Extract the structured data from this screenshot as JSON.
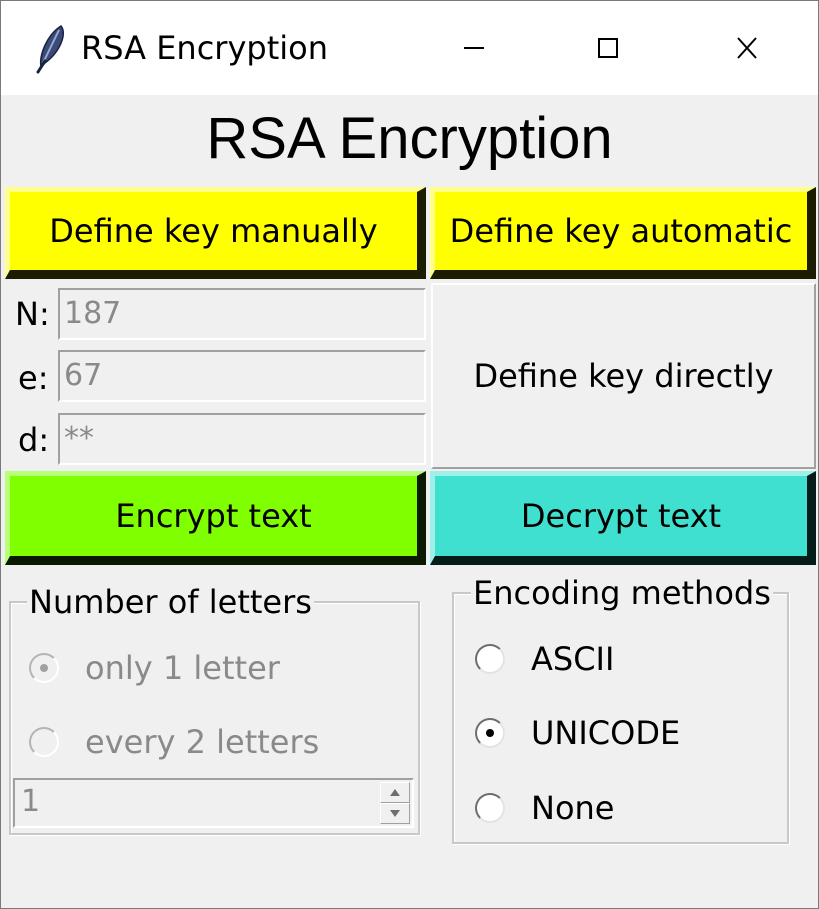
{
  "window": {
    "title": "RSA Encryption",
    "icon": "feather-icon",
    "controls": [
      "minimize-icon",
      "maximize-icon",
      "close-icon"
    ]
  },
  "header": {
    "title": "RSA Encryption"
  },
  "buttons": {
    "define_manual": "Define key manually",
    "define_auto": "Define key automatic",
    "define_direct": "Define key directly",
    "encrypt": "Encrypt text",
    "decrypt": "Decrypt text"
  },
  "key_fields": {
    "n": {
      "label": "N:",
      "value": "187"
    },
    "e": {
      "label": "e:",
      "value": "67"
    },
    "d": {
      "label": "d:",
      "value": "**"
    }
  },
  "letters_group": {
    "title": "Number of letters",
    "options": [
      {
        "label": "only 1 letter",
        "selected": true
      },
      {
        "label": "every 2 letters",
        "selected": false
      }
    ],
    "spin_value": "1"
  },
  "encoding_group": {
    "title": "Encoding methods",
    "options": [
      {
        "label": "ASCII",
        "selected": false
      },
      {
        "label": "UNICODE",
        "selected": true
      },
      {
        "label": "None",
        "selected": false
      }
    ]
  },
  "colors": {
    "yellow": "#ffff00",
    "green": "#7fff00",
    "cyan": "#40e0d0",
    "background": "#f0f0f0"
  }
}
